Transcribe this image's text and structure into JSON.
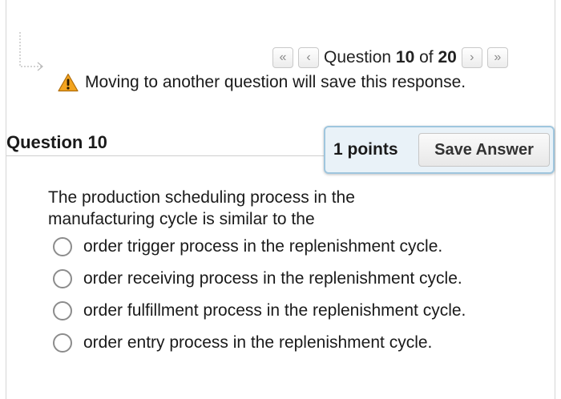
{
  "navigation": {
    "first_glyph": "«",
    "prev_glyph": "‹",
    "next_glyph": "›",
    "last_glyph": "»",
    "question_prefix": "Question ",
    "current": "10",
    "of_text": " of ",
    "total": "20"
  },
  "warning": {
    "icon": "warning-triangle-icon",
    "text": "Moving to another question will save this response.",
    "color": "#f0a01e"
  },
  "question": {
    "title": "Question 10",
    "points": "1 points",
    "save_label": "Save Answer",
    "prompt": "The production scheduling process in the manufacturing cycle is similar to the",
    "options": [
      "order trigger process in the replenishment cycle.",
      "order receiving process in the replenishment cycle.",
      "order fulfillment process in the replenishment cycle.",
      "order entry process in the replenishment cycle."
    ]
  },
  "colors": {
    "points_box_bg": "#e9f2f8",
    "points_box_border": "#9fc6de"
  }
}
